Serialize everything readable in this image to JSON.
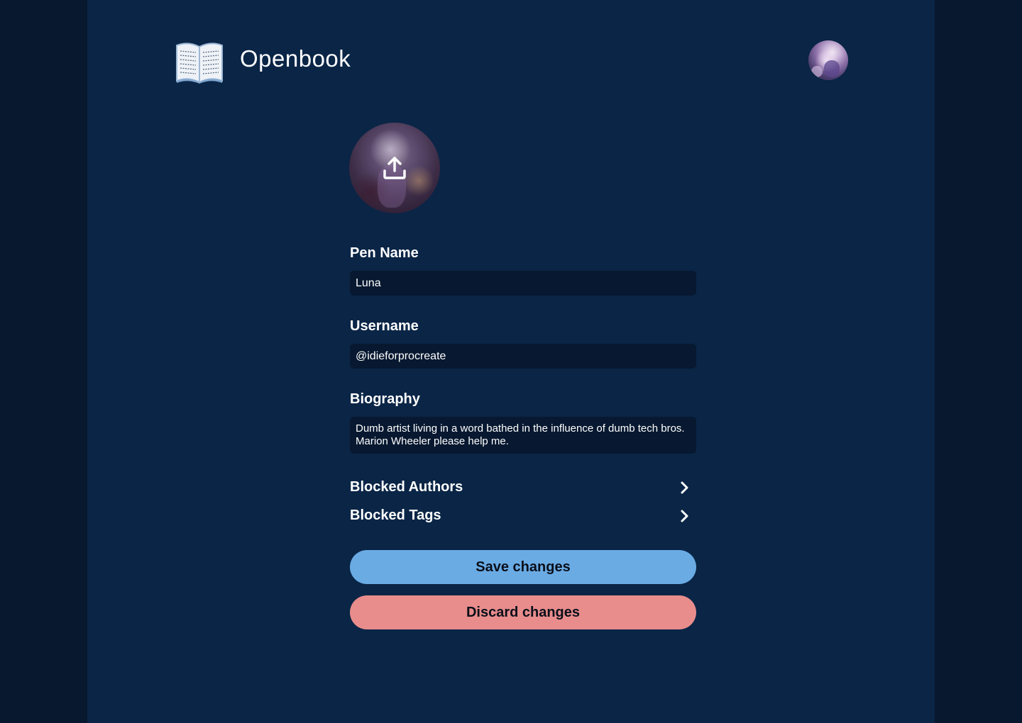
{
  "header": {
    "brand": "Openbook",
    "logo_icon": "open-book-icon",
    "profile_avatar_icon": "user-avatar"
  },
  "profile": {
    "upload_icon": "upload-icon"
  },
  "form": {
    "pen_name": {
      "label": "Pen Name",
      "value": "Luna"
    },
    "username": {
      "label": "Username",
      "value": "@idieforprocreate"
    },
    "biography": {
      "label": "Biography",
      "value": "Dumb artist living in a word bathed in the influence of dumb tech bros. Marion Wheeler please help me."
    }
  },
  "links": [
    {
      "label": "Blocked Authors",
      "icon": "chevron-right-icon"
    },
    {
      "label": "Blocked Tags",
      "icon": "chevron-right-icon"
    }
  ],
  "actions": {
    "save_label": "Save changes",
    "discard_label": "Discard changes"
  },
  "colors": {
    "background": "#0a2546",
    "outer_background": "#08182f",
    "input_background": "#071830",
    "save_button": "#6aabe4",
    "discard_button": "#e88d8c"
  }
}
